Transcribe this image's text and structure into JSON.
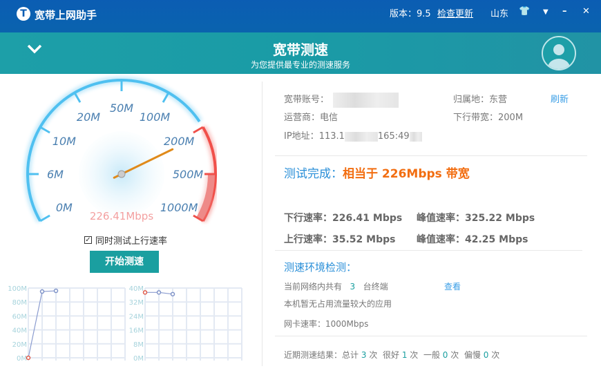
{
  "app": {
    "title": "宽带上网助手",
    "version": "版本：9.5",
    "check_update": "检查更新",
    "region": "山东"
  },
  "banner": {
    "title": "宽带测速",
    "subtitle": "为您提供最专业的测速服务"
  },
  "gauge": {
    "labels": [
      "0M",
      "6M",
      "10M",
      "20M",
      "50M",
      "100M",
      "200M",
      "500M",
      "1000M"
    ],
    "reading": "226.41Mbps",
    "value_mbps": 226.41,
    "red_zone_from": "200M",
    "accent": "#4fc0f0",
    "danger": "#f0504a"
  },
  "left": {
    "upload_checkbox": "同时测试上行速率",
    "upload_checked": true,
    "start_button": "开始测速"
  },
  "info": {
    "account_label": "宽带账号：",
    "location_label": "归属地：",
    "location": "东营",
    "refresh": "刷新",
    "isp_label": "运营商：",
    "isp": "电信",
    "bandwidth_label": "下行带宽：",
    "bandwidth": "200M",
    "ip_label": "IP地址：",
    "ip_a": "113.1",
    "ip_b": "165:49"
  },
  "result": {
    "prefix": "测试完成：",
    "text": "相当于 226Mbps 带宽",
    "down_label": "下行速率：",
    "down": "226.41 Mbps",
    "peak_label": "峰值速率：",
    "down_peak": "325.22 Mbps",
    "up_label": "上行速率：",
    "up": "35.52 Mbps",
    "up_peak": "42.25 Mbps"
  },
  "env": {
    "title": "测速环境检测：",
    "devices_pre": "当前网络内共有",
    "devices": "3",
    "devices_post": "台终端",
    "view": "查看",
    "apps": "本机暂无占用流量较大的应用",
    "nic": "网卡速率：1000Mbps"
  },
  "history": {
    "pre": "近期测速结果：总计",
    "total": "3",
    "unit": "次",
    "good_label": "很好",
    "good": "1",
    "ok_label": "一般",
    "ok": "0",
    "slow_label": "偏慢",
    "slow": "0"
  },
  "chart_data": [
    {
      "type": "line",
      "title": "下行",
      "yticks": [
        "0M",
        "20M",
        "40M",
        "60M",
        "80M",
        "100M"
      ],
      "ylim": [
        0,
        100
      ],
      "x": [
        0,
        1,
        2
      ],
      "values": [
        0,
        95,
        96
      ],
      "grid": true
    },
    {
      "type": "line",
      "title": "上行",
      "yticks": [
        "0M",
        "8M",
        "16M",
        "24M",
        "32M",
        "40M"
      ],
      "ylim": [
        0,
        40
      ],
      "x": [
        0,
        1,
        2
      ],
      "values": [
        37.5,
        37.5,
        36.5
      ],
      "grid": true
    }
  ]
}
